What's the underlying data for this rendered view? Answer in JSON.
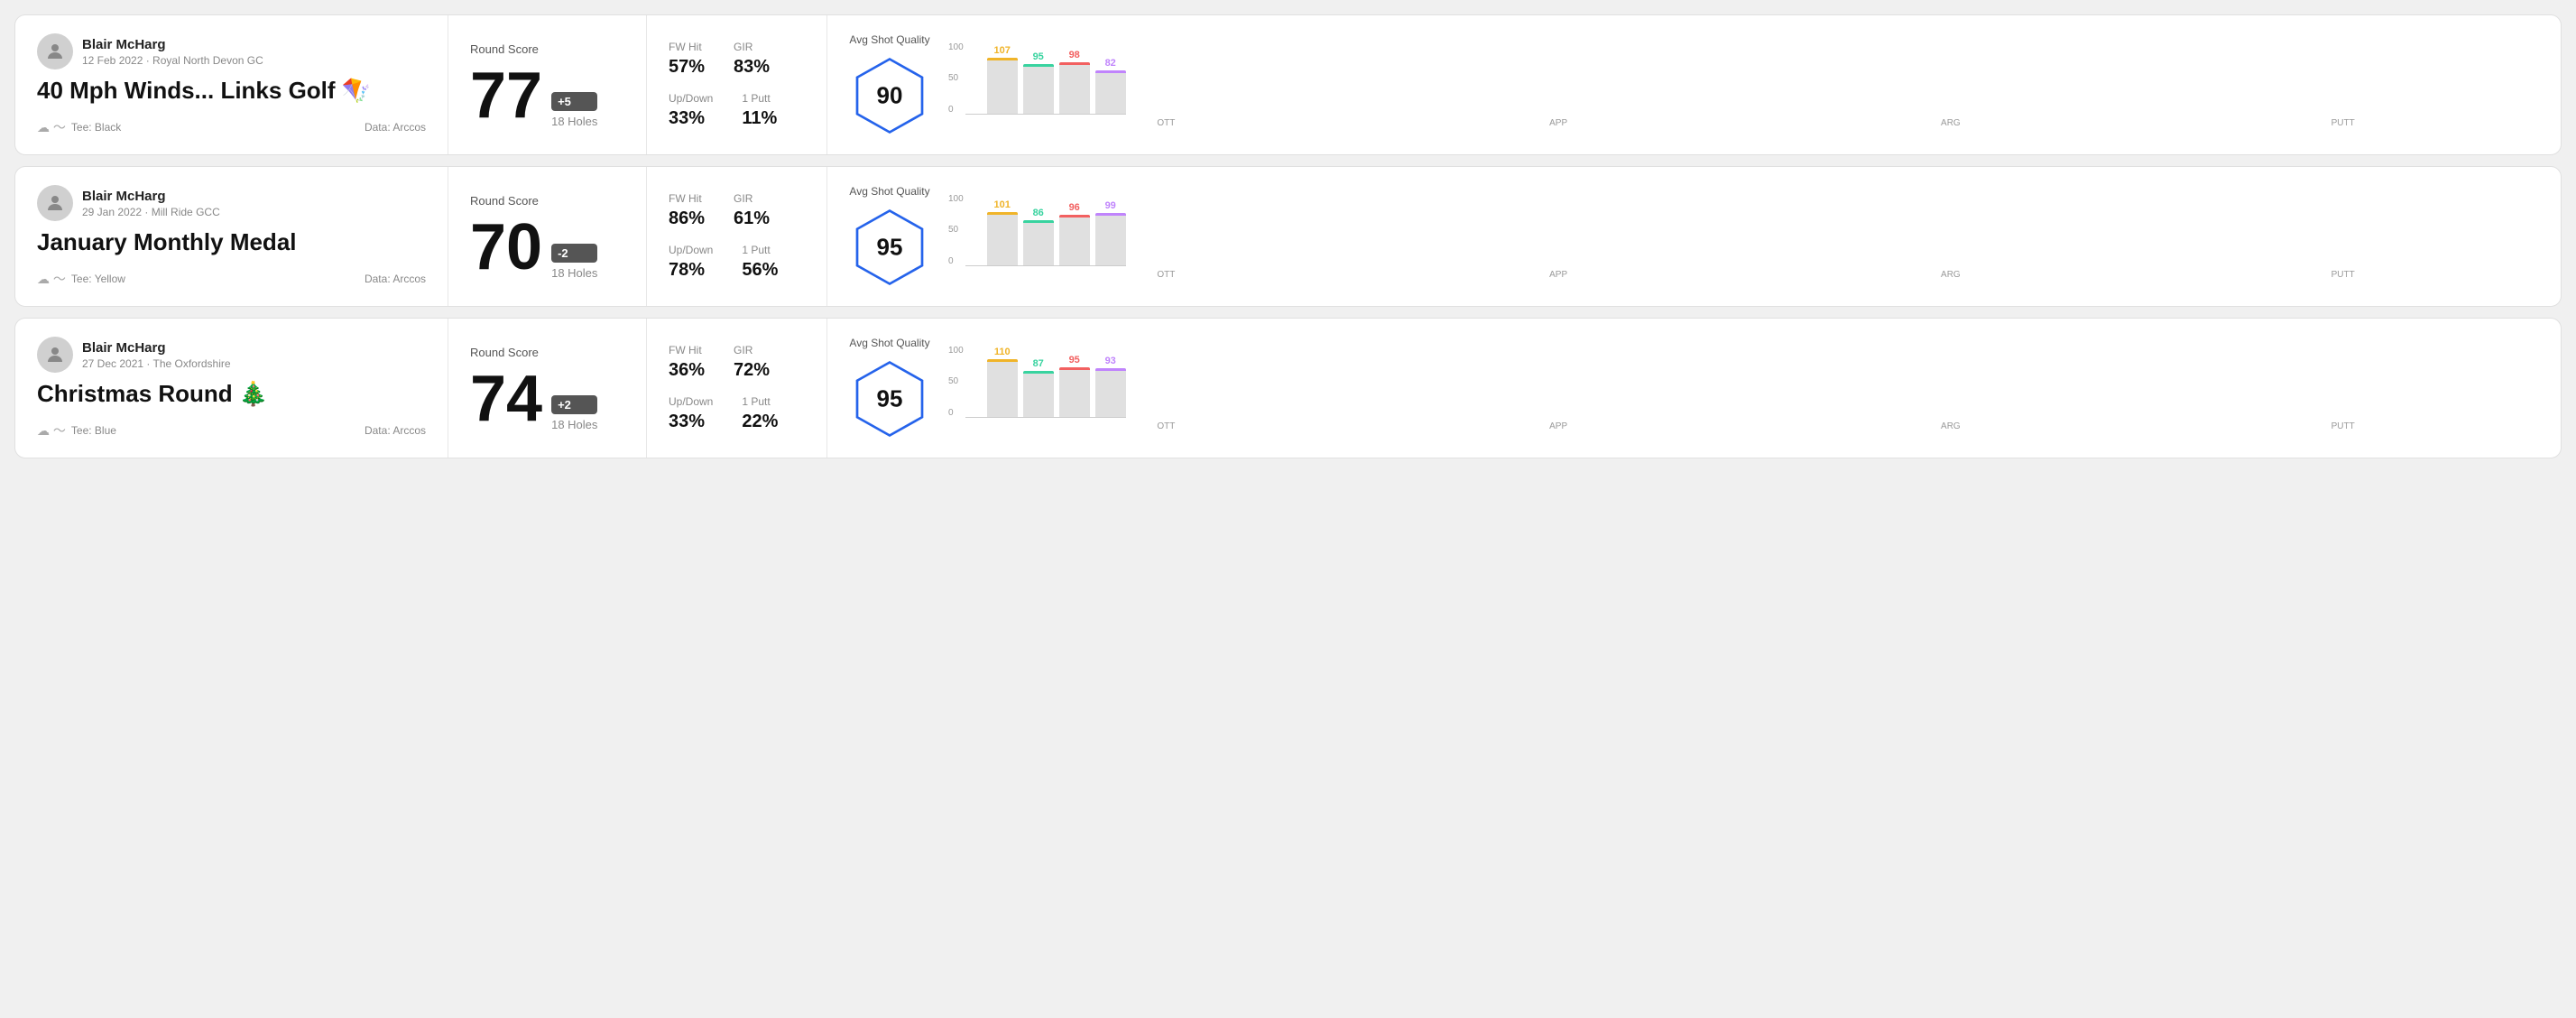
{
  "rounds": [
    {
      "id": "round1",
      "user": {
        "name": "Blair McHarg",
        "meta": "12 Feb 2022 · Royal North Devon GC"
      },
      "title": "40 Mph Winds... Links Golf 🪁",
      "tee": "Black",
      "data_source": "Arccos",
      "score": {
        "label": "Round Score",
        "number": "77",
        "badge": "+5",
        "holes": "18 Holes"
      },
      "stats": {
        "fw_hit_label": "FW Hit",
        "fw_hit_value": "57%",
        "gir_label": "GIR",
        "gir_value": "83%",
        "updown_label": "Up/Down",
        "updown_value": "33%",
        "one_putt_label": "1 Putt",
        "one_putt_value": "11%"
      },
      "avg_quality": {
        "label": "Avg Shot Quality",
        "score": "90"
      },
      "chart": {
        "bars": [
          {
            "label": "OTT",
            "value": 107,
            "color": "#f0b429"
          },
          {
            "label": "APP",
            "value": 95,
            "color": "#38d39f"
          },
          {
            "label": "ARG",
            "value": 98,
            "color": "#f26060"
          },
          {
            "label": "PUTT",
            "value": 82,
            "color": "#c084fc"
          }
        ],
        "y_max": 120,
        "y_labels": [
          "100",
          "50",
          "0"
        ]
      }
    },
    {
      "id": "round2",
      "user": {
        "name": "Blair McHarg",
        "meta": "29 Jan 2022 · Mill Ride GCC"
      },
      "title": "January Monthly Medal",
      "tee": "Yellow",
      "data_source": "Arccos",
      "score": {
        "label": "Round Score",
        "number": "70",
        "badge": "-2",
        "holes": "18 Holes"
      },
      "stats": {
        "fw_hit_label": "FW Hit",
        "fw_hit_value": "86%",
        "gir_label": "GIR",
        "gir_value": "61%",
        "updown_label": "Up/Down",
        "updown_value": "78%",
        "one_putt_label": "1 Putt",
        "one_putt_value": "56%"
      },
      "avg_quality": {
        "label": "Avg Shot Quality",
        "score": "95"
      },
      "chart": {
        "bars": [
          {
            "label": "OTT",
            "value": 101,
            "color": "#f0b429"
          },
          {
            "label": "APP",
            "value": 86,
            "color": "#38d39f"
          },
          {
            "label": "ARG",
            "value": 96,
            "color": "#f26060"
          },
          {
            "label": "PUTT",
            "value": 99,
            "color": "#c084fc"
          }
        ],
        "y_max": 120,
        "y_labels": [
          "100",
          "50",
          "0"
        ]
      }
    },
    {
      "id": "round3",
      "user": {
        "name": "Blair McHarg",
        "meta": "27 Dec 2021 · The Oxfordshire"
      },
      "title": "Christmas Round 🎄",
      "tee": "Blue",
      "data_source": "Arccos",
      "score": {
        "label": "Round Score",
        "number": "74",
        "badge": "+2",
        "holes": "18 Holes"
      },
      "stats": {
        "fw_hit_label": "FW Hit",
        "fw_hit_value": "36%",
        "gir_label": "GIR",
        "gir_value": "72%",
        "updown_label": "Up/Down",
        "updown_value": "33%",
        "one_putt_label": "1 Putt",
        "one_putt_value": "22%"
      },
      "avg_quality": {
        "label": "Avg Shot Quality",
        "score": "95"
      },
      "chart": {
        "bars": [
          {
            "label": "OTT",
            "value": 110,
            "color": "#f0b429"
          },
          {
            "label": "APP",
            "value": 87,
            "color": "#38d39f"
          },
          {
            "label": "ARG",
            "value": 95,
            "color": "#f26060"
          },
          {
            "label": "PUTT",
            "value": 93,
            "color": "#c084fc"
          }
        ],
        "y_max": 120,
        "y_labels": [
          "100",
          "50",
          "0"
        ]
      }
    }
  ]
}
